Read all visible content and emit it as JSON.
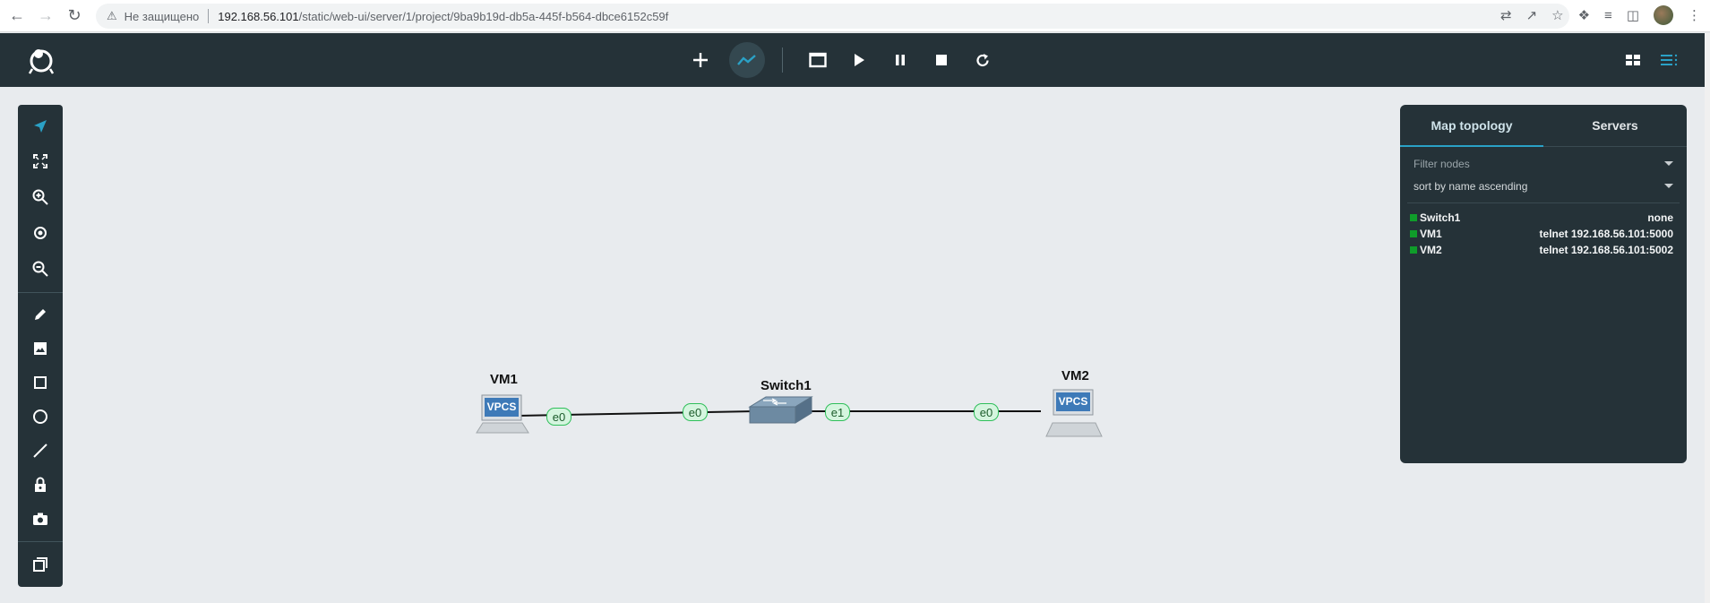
{
  "browser": {
    "security_label": "Не защищено",
    "url_host": "192.168.56.101",
    "url_path": "/static/web-ui/server/1/project/9ba9b19d-db5a-445f-b564-dbce6152c59f"
  },
  "toolbar": {
    "buttons": [
      "add-node",
      "show-links",
      "console",
      "start",
      "pause",
      "stop",
      "reload"
    ],
    "active_button": "show-links",
    "accent_color": "#2aa1c6"
  },
  "tools": [
    "select",
    "fit-to-screen",
    "zoom-in",
    "reset-zoom",
    "zoom-out",
    "draw",
    "insert-image",
    "rectangle",
    "ellipse",
    "line",
    "lock",
    "screenshot",
    "layers"
  ],
  "topology": {
    "nodes": [
      {
        "name": "VM1",
        "icon_text": "VPCS"
      },
      {
        "name": "Switch1"
      },
      {
        "name": "VM2",
        "icon_text": "VPCS"
      }
    ],
    "ports": [
      "e0",
      "e0",
      "e1",
      "e0"
    ]
  },
  "panel": {
    "tabs": [
      "Map topology",
      "Servers"
    ],
    "filter_placeholder": "Filter nodes",
    "sort_value": "sort by name ascending",
    "status_color": "#0f9d2a",
    "items": [
      {
        "name": "Switch1",
        "console": "none"
      },
      {
        "name": "VM1",
        "console": "telnet 192.168.56.101:5000"
      },
      {
        "name": "VM2",
        "console": "telnet 192.168.56.101:5002"
      }
    ]
  }
}
